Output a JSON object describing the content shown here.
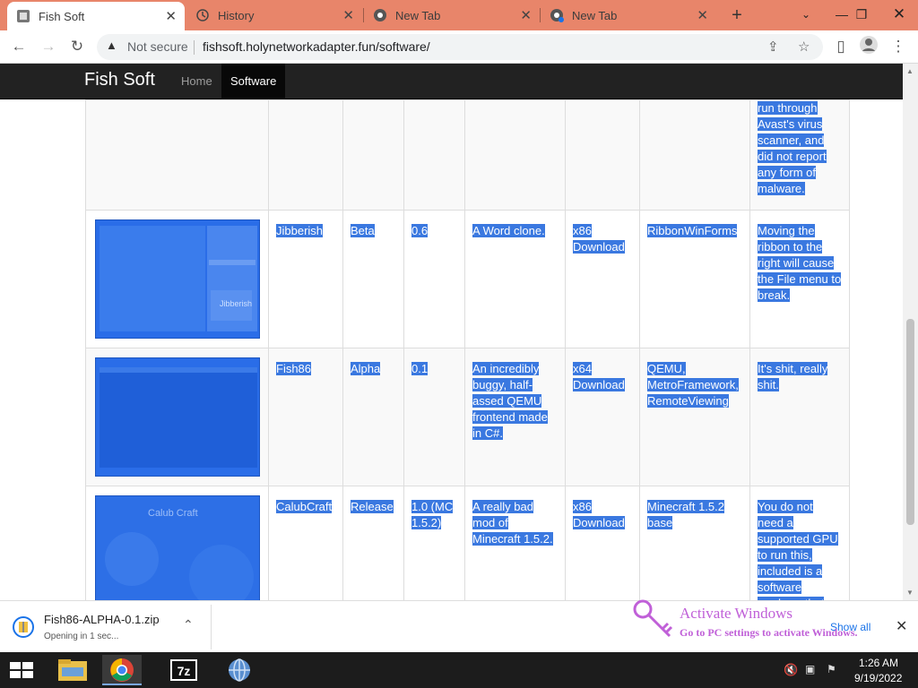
{
  "browser": {
    "tabs": [
      {
        "title": "Fish Soft",
        "active": true
      },
      {
        "title": "History",
        "active": false
      },
      {
        "title": "New Tab",
        "active": false
      },
      {
        "title": "New Tab",
        "active": false
      }
    ],
    "security_label": "Not secure",
    "url": "fishsoft.holynetworkadapter.fun/software/",
    "tab_bar_color": "#e8856a"
  },
  "site": {
    "brand": "Fish Soft",
    "nav": [
      {
        "label": "Home",
        "active": false
      },
      {
        "label": "Software",
        "active": true
      }
    ]
  },
  "table": {
    "partial_row_note_lines": [
      "run through",
      "Avast's virus",
      "scanner, and",
      "did not report",
      "any form of",
      "malware."
    ],
    "rows": [
      {
        "name": "Jibberish",
        "stage": "Beta",
        "version": "0.6",
        "description": "A Word clone.",
        "downloads": [
          "x86",
          "Download"
        ],
        "dependencies": "RibbonWinForms",
        "notes": "Moving the ribbon to the right will cause the File menu to break.",
        "thumb_caption": "Jibberish"
      },
      {
        "name": "Fish86",
        "stage": "Alpha",
        "version": "0.1",
        "description": "An incredibly buggy, half-assed QEMU frontend made in C#.",
        "downloads": [
          "x64",
          "Download"
        ],
        "dependencies": "QEMU, MetroFramework, RemoteViewing",
        "notes": "It's shit, really shit.",
        "thumb_caption": ""
      },
      {
        "name": "CalubCraft",
        "stage": "Release",
        "version": "1.0 (MC 1.5.2)",
        "description": "A really bad mod of Minecraft 1.5.2.",
        "downloads": [
          "x86",
          "Download"
        ],
        "dependencies": "Minecraft 1.5.2 base",
        "notes": "You do not need a supported GPU to run this, included is a software renderer that",
        "thumb_caption": "Calub Craft"
      }
    ],
    "selection_color": "#3a78e0"
  },
  "download_bar": {
    "filename": "Fish86-ALPHA-0.1.zip",
    "status": "Opening in 1 sec...",
    "show_all": "Show all"
  },
  "watermark": {
    "title": "Activate Windows",
    "subtitle": "Go to PC settings to activate Windows."
  },
  "taskbar": {
    "time": "1:26 AM",
    "date": "9/19/2022",
    "apps": [
      "file-explorer",
      "chrome",
      "7zip",
      "globe"
    ]
  }
}
